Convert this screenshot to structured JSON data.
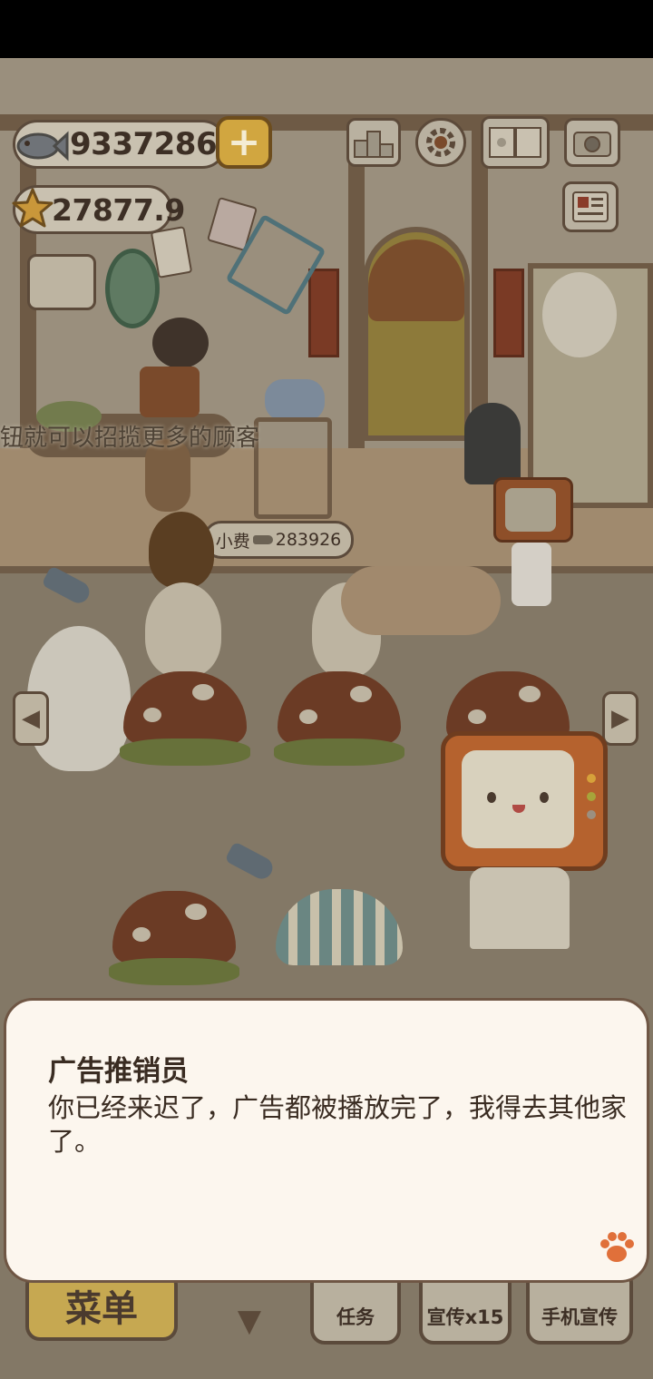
{
  "currency": {
    "fish": "9337286",
    "stars": "27877.9"
  },
  "ticker": "钮就可以招揽更多的顾客",
  "tip": {
    "label": "小费",
    "amount": "283926"
  },
  "dialog": {
    "speaker": "广告推销员",
    "message": "你已经来迟了，广告都被播放完了，我得去其他家了。"
  },
  "bottom_bar": {
    "menu": "菜单",
    "tasks": "任务",
    "promote": "宣传x15",
    "phone_promote": "手机宣传"
  },
  "icons": {
    "rank": "ranking-podium-icon",
    "settings": "gear-icon",
    "book": "recipe-book-icon",
    "camera": "camera-icon",
    "news": "newspaper-icon",
    "add": "plus-icon",
    "paw": "paw-icon"
  },
  "colors": {
    "dialog_bg": "#fcf6ee",
    "dialog_border": "#6f5644",
    "menu_button": "#c6a851",
    "plus_button": "#d1a640",
    "paw": "#e0703a"
  }
}
